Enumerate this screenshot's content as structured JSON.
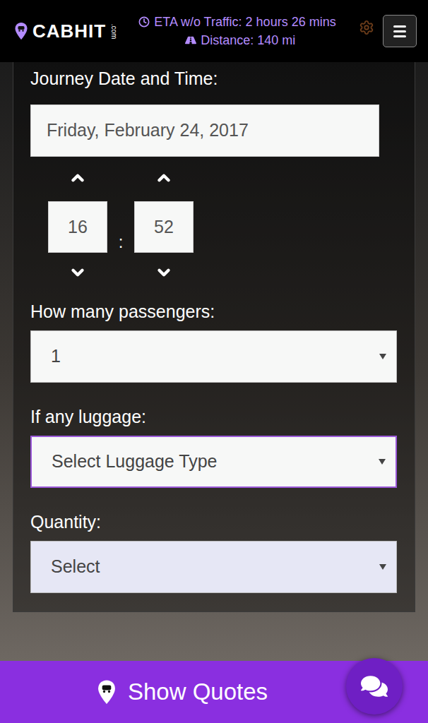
{
  "header": {
    "logo": "CABHIT",
    "logo_suffix": ".com",
    "eta": "ETA w/o Traffic: 2 hours 26 mins",
    "distance": "Distance: 140 mi"
  },
  "form": {
    "date_label": "Journey Date and Time:",
    "date": "Friday, February 24, 2017",
    "hour": "16",
    "minute": "52",
    "time_separator": ":",
    "selects": [
      {
        "label": "How many passengers:",
        "value": "1",
        "focused": false,
        "disabled": false
      },
      {
        "label": "If any luggage:",
        "value": "Select Luggage Type",
        "focused": true,
        "disabled": false
      },
      {
        "label": "Quantity:",
        "value": "Select",
        "focused": false,
        "disabled": true
      }
    ]
  },
  "button": "Show Quotes"
}
